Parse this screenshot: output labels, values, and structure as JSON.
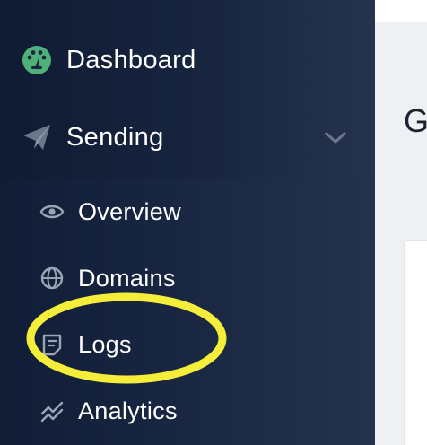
{
  "sidebar": {
    "items": [
      {
        "label": "Dashboard",
        "icon": "dashboard-gauge-icon"
      },
      {
        "label": "Sending",
        "icon": "paper-plane-icon",
        "expanded": true
      }
    ],
    "sending_subitems": [
      {
        "label": "Overview",
        "icon": "eye-icon"
      },
      {
        "label": "Domains",
        "icon": "globe-icon"
      },
      {
        "label": "Logs",
        "icon": "log-document-icon",
        "highlighted": true
      },
      {
        "label": "Analytics",
        "icon": "analytics-chart-icon"
      }
    ]
  },
  "main": {
    "title_visible": "G"
  },
  "colors": {
    "sidebar_dark": "#111d36",
    "sidebar_light": "#24324d",
    "dashboard_icon": "#4fb07a",
    "sub_icon": "#9aa4b4",
    "highlight": "#f4ee3a"
  }
}
